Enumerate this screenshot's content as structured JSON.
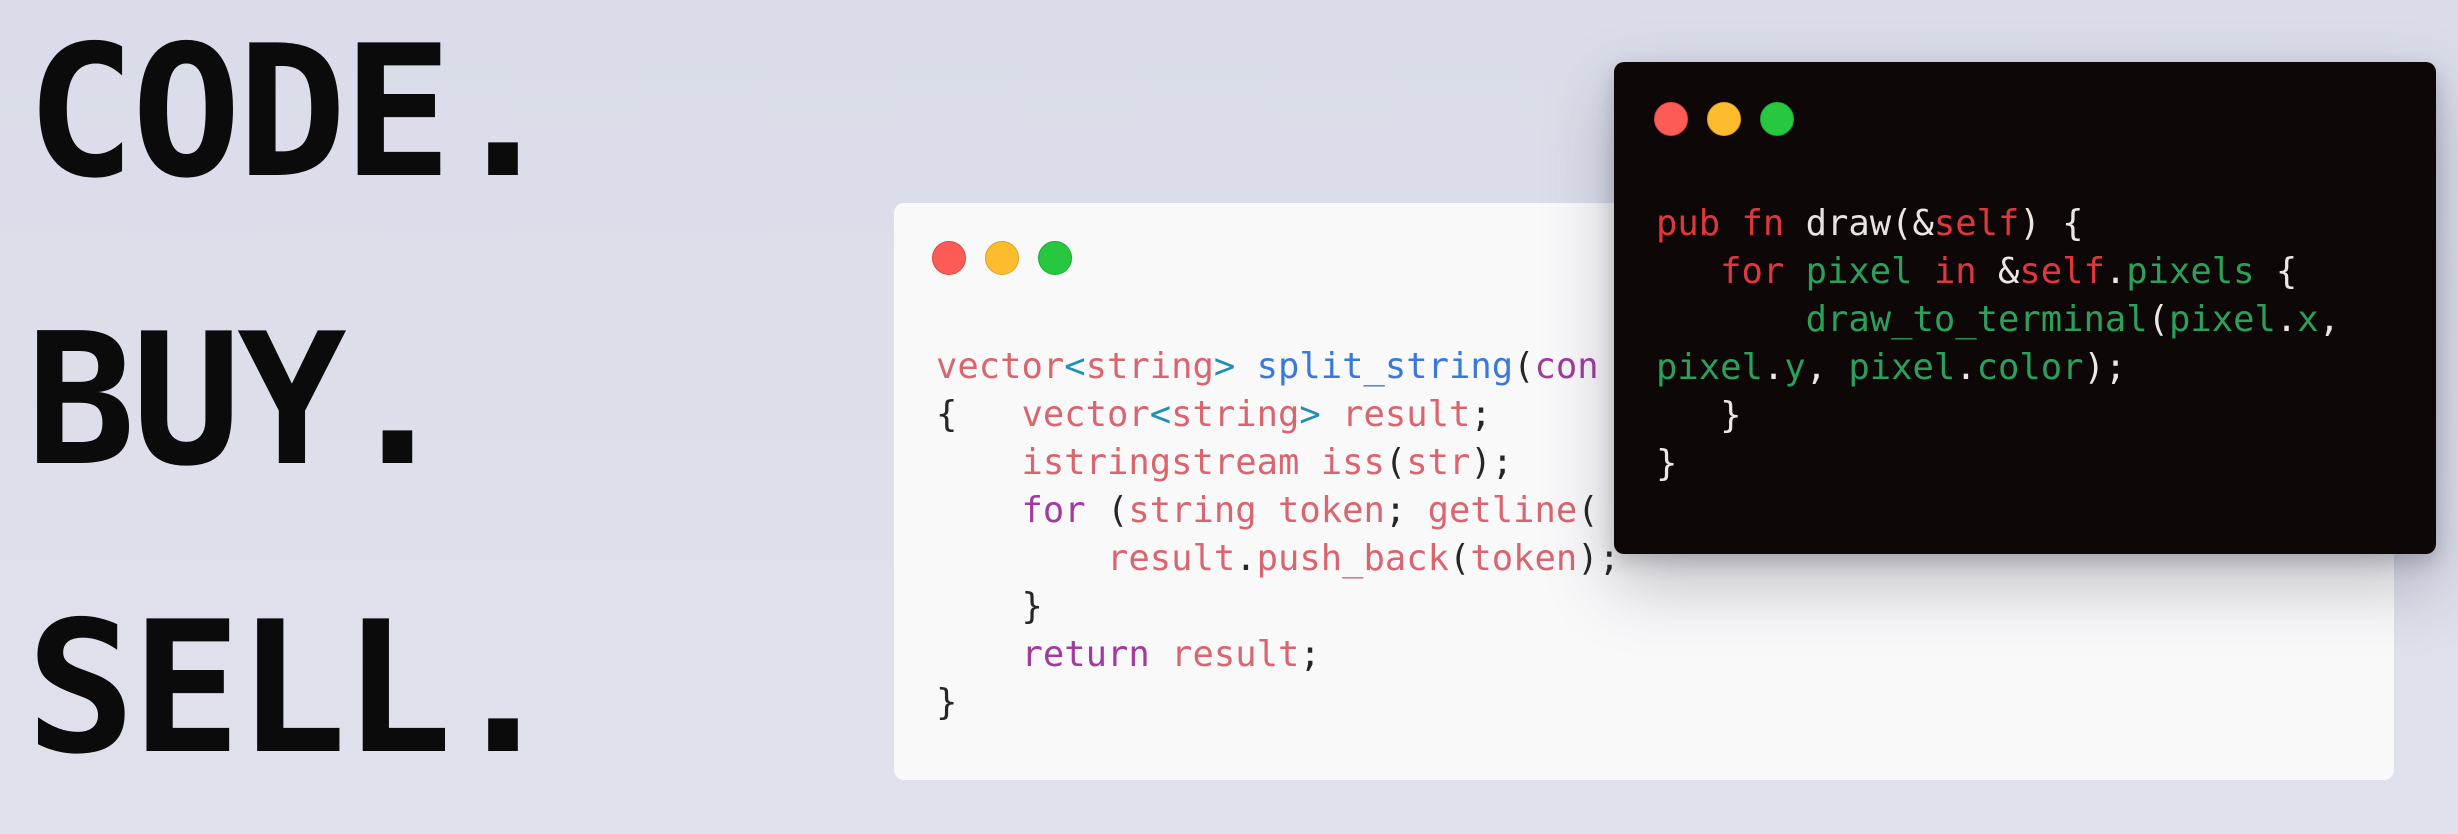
{
  "headline": {
    "line1": "CODE.",
    "line2": "BUY.",
    "line3": "SELL."
  },
  "colors": {
    "background": "#dcdfea",
    "headline": "#0b0b0b",
    "light_window_bg": "#f9f9fa",
    "dark_window_bg": "#0d0807",
    "traffic_red": "#fd5b55",
    "traffic_yellow": "#fdbc2e",
    "traffic_green": "#27c840"
  },
  "light_window": {
    "language": "C++",
    "lines": [
      [
        {
          "t": "vector",
          "c": "l-type"
        },
        {
          "t": "<",
          "c": "l-angle"
        },
        {
          "t": "string",
          "c": "l-type"
        },
        {
          "t": ">",
          "c": "l-angle"
        },
        {
          "t": " ",
          "c": "l-punc"
        },
        {
          "t": "split_string",
          "c": "l-fn"
        },
        {
          "t": "(",
          "c": "l-punc"
        },
        {
          "t": "con",
          "c": "l-kw"
        }
      ],
      [
        {
          "t": "{   ",
          "c": "l-punc"
        },
        {
          "t": "vector",
          "c": "l-type"
        },
        {
          "t": "<",
          "c": "l-angle"
        },
        {
          "t": "string",
          "c": "l-type"
        },
        {
          "t": ">",
          "c": "l-angle"
        },
        {
          "t": " ",
          "c": "l-punc"
        },
        {
          "t": "result",
          "c": "l-var"
        },
        {
          "t": ";",
          "c": "l-punc"
        }
      ],
      [
        {
          "t": "    ",
          "c": "l-punc"
        },
        {
          "t": "istringstream",
          "c": "l-type"
        },
        {
          "t": " ",
          "c": "l-punc"
        },
        {
          "t": "iss",
          "c": "l-var"
        },
        {
          "t": "(",
          "c": "l-punc"
        },
        {
          "t": "str",
          "c": "l-var"
        },
        {
          "t": ");",
          "c": "l-punc"
        }
      ],
      [
        {
          "t": "    ",
          "c": "l-punc"
        },
        {
          "t": "for",
          "c": "l-kw"
        },
        {
          "t": " (",
          "c": "l-punc"
        },
        {
          "t": "string",
          "c": "l-type"
        },
        {
          "t": " ",
          "c": "l-punc"
        },
        {
          "t": "token",
          "c": "l-var"
        },
        {
          "t": "; ",
          "c": "l-punc"
        },
        {
          "t": "getline",
          "c": "l-var"
        },
        {
          "t": "(",
          "c": "l-punc"
        }
      ],
      [
        {
          "t": "        ",
          "c": "l-punc"
        },
        {
          "t": "result",
          "c": "l-var"
        },
        {
          "t": ".",
          "c": "l-punc"
        },
        {
          "t": "push_back",
          "c": "l-var"
        },
        {
          "t": "(",
          "c": "l-punc"
        },
        {
          "t": "token",
          "c": "l-var"
        },
        {
          "t": ");",
          "c": "l-punc"
        }
      ],
      [
        {
          "t": "    }",
          "c": "l-punc"
        }
      ],
      [
        {
          "t": "    ",
          "c": "l-punc"
        },
        {
          "t": "return",
          "c": "l-kw"
        },
        {
          "t": " ",
          "c": "l-punc"
        },
        {
          "t": "result",
          "c": "l-var"
        },
        {
          "t": ";",
          "c": "l-punc"
        }
      ],
      [
        {
          "t": "}",
          "c": "l-punc"
        }
      ]
    ]
  },
  "dark_window": {
    "language": "Rust",
    "lines": [
      [
        {
          "t": "pub",
          "c": "d-kw"
        },
        {
          "t": " ",
          "c": "d-punc"
        },
        {
          "t": "fn",
          "c": "d-kw"
        },
        {
          "t": " ",
          "c": "d-punc"
        },
        {
          "t": "draw",
          "c": "d-fn"
        },
        {
          "t": "(&",
          "c": "d-punc"
        },
        {
          "t": "self",
          "c": "d-self"
        },
        {
          "t": ") {",
          "c": "d-punc"
        }
      ],
      [
        {
          "t": "   ",
          "c": "d-punc"
        },
        {
          "t": "for",
          "c": "d-kw"
        },
        {
          "t": " ",
          "c": "d-punc"
        },
        {
          "t": "pixel",
          "c": "d-id"
        },
        {
          "t": " ",
          "c": "d-punc"
        },
        {
          "t": "in",
          "c": "d-kw"
        },
        {
          "t": " &",
          "c": "d-punc"
        },
        {
          "t": "self",
          "c": "d-self"
        },
        {
          "t": ".",
          "c": "d-punc"
        },
        {
          "t": "pixels",
          "c": "d-id"
        },
        {
          "t": " {",
          "c": "d-punc"
        }
      ],
      [
        {
          "t": "       ",
          "c": "d-punc"
        },
        {
          "t": "draw_to_terminal",
          "c": "d-id"
        },
        {
          "t": "(",
          "c": "d-punc"
        },
        {
          "t": "pixel",
          "c": "d-id"
        },
        {
          "t": ".",
          "c": "d-punc"
        },
        {
          "t": "x",
          "c": "d-id"
        },
        {
          "t": ",",
          "c": "d-punc"
        }
      ],
      [
        {
          "t": "pixel",
          "c": "d-id"
        },
        {
          "t": ".",
          "c": "d-punc"
        },
        {
          "t": "y",
          "c": "d-id"
        },
        {
          "t": ", ",
          "c": "d-punc"
        },
        {
          "t": "pixel",
          "c": "d-id"
        },
        {
          "t": ".",
          "c": "d-punc"
        },
        {
          "t": "color",
          "c": "d-id"
        },
        {
          "t": ");",
          "c": "d-punc"
        }
      ],
      [
        {
          "t": "   }",
          "c": "d-punc"
        }
      ],
      [
        {
          "t": "}",
          "c": "d-punc"
        }
      ]
    ]
  }
}
